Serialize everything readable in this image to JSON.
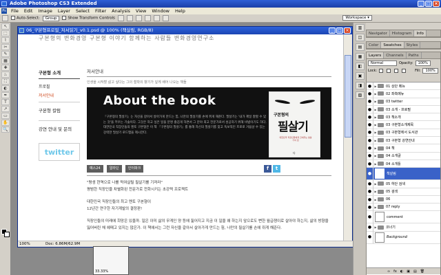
{
  "app": {
    "title": "Adobe Photoshop CS3 Extended",
    "window_buttons": [
      "_",
      "□",
      "×"
    ]
  },
  "menu": [
    "File",
    "Edit",
    "Image",
    "Layer",
    "Select",
    "Filter",
    "Analysis",
    "View",
    "Window",
    "Help"
  ],
  "options": {
    "auto_select_label": "Auto-Select:",
    "auto_select_value": "Group",
    "show_transform_label": "Show Transform Controls",
    "workspace_label": "Workspace ▾"
  },
  "document": {
    "title": "06_구본형프로필_저서읽기_v0.1.psd @ 100% (책살림, RGB/8)",
    "zoom": "100%",
    "doc_size": "Doc: 6.86M/62.9M",
    "nav_zoom": "33.33%"
  },
  "page": {
    "topnav": "구본형의 변화경영      구본형 이야기      함께하는 사람들      변화경영연구소",
    "sidebar": {
      "heading": "구본형 소개",
      "links": [
        "프로필",
        "저서안내"
      ],
      "section2": "구본형 칼럼",
      "section3": "강연 안내 및 문의",
      "twitter": "twitter"
    },
    "main": {
      "breadcrumb": "저서안내",
      "subtitle": "인생을 시작할 삶고 싶다는 그의 철학의 향기가 깊게 배어 나오는 책들",
      "banner_headline": "About the book",
      "banner_text": "『구본형의 필살기』는 자신을 갈아서 살아가게 만드는 힘, 나만의 필살기를 손에 쥐게 해준다. 필살기는 '내가 제일 잘할 수 있는 것'을 키우는 기술이다. 그것은 하고 싶은 일을 분명 즐겁게 하면서 그 분야 최고 전문가로서 성공하기 위해 비법이기도 하다. 대한민국 직장인들의 멘토 구본형은 이 책 『구본형의 필살기』를 통해 자신의 필살기를 찾고 독보적인 프로로 거듭날 수 있는 강력한 필살기 로드맵을 제시한다.",
      "book_cover_top": "구본형의",
      "book_cover_title": "필살기",
      "book_cover_sub": "대한민국 직장인들에게 건네주는 필살기의 힘",
      "book_publisher": "다",
      "buy_buttons": [
        "예스24",
        "알라딘",
        "인터파크"
      ],
      "share_fb": "f",
      "share_tw": "t",
      "paragraphs": [
        "\"평생 현역으로 나를 먹여살릴 필살기를 기져라\"\n평범한 직장인을 차별화된 전문가로 전화시키는 초강력 프로젝트",
        "대한민국 직장인들의 최고 멘토 구본형이\n12년간 연구한 자기계발의 결정판!",
        "직장인들의 미래에 희망은 있을까. 일은 이미 삶의 무게인 양 등에 짊어지고 지금 이 일을 왜 하는지 앞으로도 뻔한 월급쟁이로 살아야 하는지, 삶의 방향을 잃어버린 채 헤매고 있지는 않은가. 이 책에서는 그런 자신을 갈아서 살아가게 만드는 힘, 나만의 필살기를 손에 쥐게 해준다."
      ]
    }
  },
  "panels": {
    "group1_tabs": [
      "Navigator",
      "Histogram",
      "Info"
    ],
    "group2_tabs": [
      "Color",
      "Swatches",
      "Styles"
    ],
    "layers_tabs": [
      "Layers",
      "Channels",
      "Paths"
    ],
    "blend_mode": "Normal",
    "opacity_label": "Opacity:",
    "opacity_value": "100%",
    "lock_label": "Lock:",
    "fill_label": "Fill:",
    "fill_value": "100%",
    "layers": [
      {
        "name": "01 상단 메뉴",
        "type": "folder",
        "tall": false
      },
      {
        "name": "02 좌측메뉴",
        "type": "folder",
        "tall": false
      },
      {
        "name": "03 twitter",
        "type": "folder",
        "tall": false
      },
      {
        "name": "03 소개 - 프로필",
        "type": "folder",
        "tall": false
      },
      {
        "name": "03 책소개",
        "type": "folder",
        "tall": false
      },
      {
        "name": "03 구본형소개제목",
        "type": "folder",
        "tall": false
      },
      {
        "name": "03 구본형에서 도서관",
        "type": "folder",
        "tall": false
      },
      {
        "name": "03 구본형 강연안내",
        "type": "folder",
        "tall": false
      },
      {
        "name": "04 책",
        "type": "folder",
        "tall": false
      },
      {
        "name": "04 소개글",
        "type": "folder",
        "tall": false
      },
      {
        "name": "04 소개틀",
        "type": "folder",
        "tall": false
      },
      {
        "name": "책살림",
        "type": "layer",
        "tall": true,
        "selected": true
      },
      {
        "name": "05 하단 검색",
        "type": "folder",
        "tall": false
      },
      {
        "name": "05 검색",
        "type": "folder",
        "tall": false
      },
      {
        "name": "06",
        "type": "folder",
        "tall": false
      },
      {
        "name": "07 reply",
        "type": "folder",
        "tall": false
      },
      {
        "name": "comment",
        "type": "layer",
        "tall": true
      },
      {
        "name": "코너기",
        "type": "folder",
        "tall": false
      },
      {
        "name": "Background",
        "type": "layer",
        "tall": true,
        "italic": true
      }
    ],
    "footer_icons": [
      "∞",
      "fx",
      "◐",
      "▣",
      "▤",
      "🗑"
    ]
  },
  "tools": [
    "↖",
    "⬚",
    "⌇",
    "✂",
    "✎",
    "▦",
    "✚",
    "♨",
    "⛶",
    "◐",
    "✒",
    "T",
    "↗",
    "▭",
    "✋",
    "🔍"
  ],
  "strip_icons": [
    "▥",
    "◫",
    "▤",
    "▦",
    "◧",
    "▣",
    "◨",
    "▧"
  ]
}
